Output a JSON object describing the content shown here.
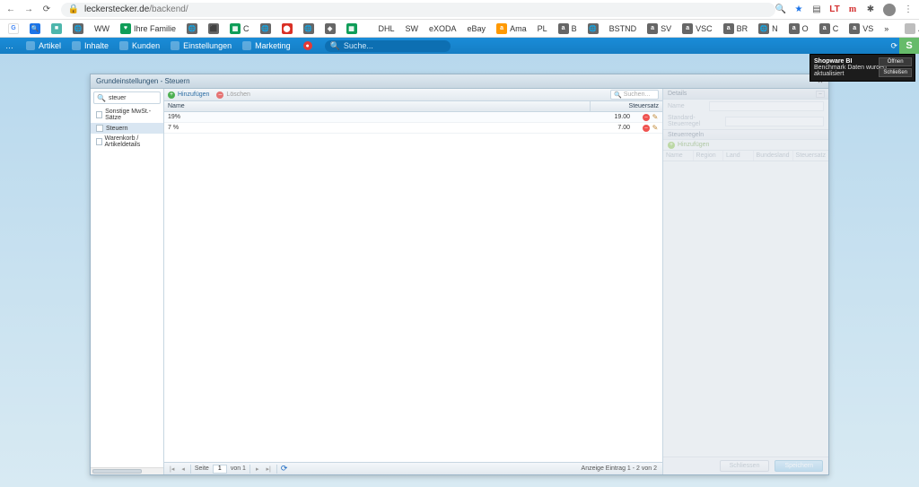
{
  "browser": {
    "url_host": "leckerstecker.de",
    "url_path": "/backend/"
  },
  "bookmarks": {
    "items": [
      {
        "label": "",
        "icon": "G",
        "cls": "g"
      },
      {
        "label": "",
        "icon": "🔍",
        "cls": "blue"
      },
      {
        "label": "",
        "icon": "■",
        "cls": "teal"
      },
      {
        "label": "",
        "icon": "🌐",
        "cls": ""
      },
      {
        "label": "WW",
        "icon": "",
        "cls": ""
      },
      {
        "label": "Ihre Familie",
        "icon": "♥",
        "cls": "green"
      },
      {
        "label": "",
        "icon": "🌐",
        "cls": ""
      },
      {
        "label": "",
        "icon": "⬛",
        "cls": ""
      },
      {
        "label": "C",
        "icon": "▦",
        "cls": "green"
      },
      {
        "label": "",
        "icon": "🌐",
        "cls": ""
      },
      {
        "label": "",
        "icon": "⬤",
        "cls": "red"
      },
      {
        "label": "",
        "icon": "🌐",
        "cls": ""
      },
      {
        "label": "",
        "icon": "◈",
        "cls": ""
      },
      {
        "label": "",
        "icon": "▦",
        "cls": "green"
      },
      {
        "label": "",
        "icon": "",
        "cls": "apple"
      },
      {
        "label": "DHL",
        "icon": "",
        "cls": "folder"
      },
      {
        "label": "SW",
        "icon": "",
        "cls": "folder"
      },
      {
        "label": "eXODA",
        "icon": "",
        "cls": "folder"
      },
      {
        "label": "eBay",
        "icon": "",
        "cls": "folder"
      },
      {
        "label": "Ama",
        "icon": "a",
        "cls": "orange"
      },
      {
        "label": "PL",
        "icon": "",
        "cls": "folder"
      },
      {
        "label": "B",
        "icon": "a",
        "cls": ""
      },
      {
        "label": "",
        "icon": "🌐",
        "cls": ""
      },
      {
        "label": "BSTND",
        "icon": "",
        "cls": "folder"
      },
      {
        "label": "SV",
        "icon": "a",
        "cls": ""
      },
      {
        "label": "VSC",
        "icon": "a",
        "cls": ""
      },
      {
        "label": "BR",
        "icon": "a",
        "cls": ""
      },
      {
        "label": "N",
        "icon": "🌐",
        "cls": ""
      },
      {
        "label": "O",
        "icon": "a",
        "cls": ""
      },
      {
        "label": "C",
        "icon": "a",
        "cls": ""
      },
      {
        "label": "VS",
        "icon": "a",
        "cls": ""
      },
      {
        "label": "»",
        "icon": "",
        "cls": ""
      }
    ],
    "other": "Andere Lesezeichen"
  },
  "swmenu": {
    "items": [
      "Artikel",
      "Inhalte",
      "Kunden",
      "Einstellungen",
      "Marketing"
    ],
    "search_placeholder": "Suche..."
  },
  "toast": {
    "title": "Shopware BI",
    "body": "Benchmark Daten wurden aktualisiert",
    "open": "Öffnen",
    "close": "Schließen"
  },
  "window": {
    "title": "Grundeinstellungen - Steuern"
  },
  "tree": {
    "search_value": "steuer",
    "items": [
      {
        "label": "Sonstige MwSt.-Sätze",
        "sel": false
      },
      {
        "label": "Steuern",
        "sel": true
      },
      {
        "label": "Warenkorb / Artikeldetails",
        "sel": false
      }
    ]
  },
  "grid": {
    "add": "Hinzufügen",
    "delete": "Löschen",
    "search_placeholder": "Suchen...",
    "col_name": "Name",
    "col_rate": "Steuersatz",
    "rows": [
      {
        "name": "19%",
        "rate": "19.00"
      },
      {
        "name": "7 %",
        "rate": "7.00"
      }
    ],
    "pager": {
      "page_label_pre": "Seite",
      "page": "1",
      "page_label_post": "von 1",
      "info": "Anzeige Eintrag 1 - 2 von 2"
    }
  },
  "detail": {
    "header": "Details",
    "name_label": "Name",
    "desc_label": "Standard-Steuerregel",
    "rules_header": "Steuerregeln",
    "rules_add": "Hinzufügen",
    "cols": [
      "Name",
      "Region",
      "Land",
      "Bundesland",
      "Steuersatz"
    ],
    "close_btn": "Schliessen",
    "save_btn": "Speichern"
  }
}
